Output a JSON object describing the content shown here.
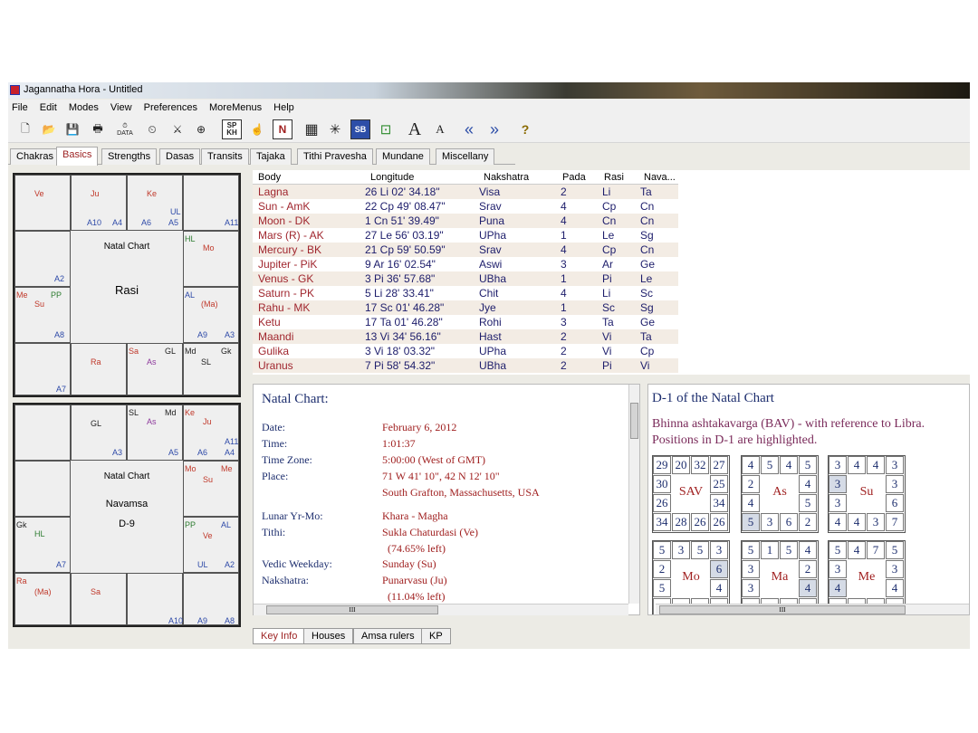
{
  "window": {
    "title": "Jagannatha Hora - Untitled"
  },
  "menu": [
    "File",
    "Edit",
    "Modes",
    "View",
    "Preferences",
    "MoreMenus",
    "Help"
  ],
  "toolbar": {
    "data_label": "DATA",
    "sp_label": "SP",
    "kh_label": "KH",
    "n_label": "N",
    "sb_label": "SB",
    "big_a": "A",
    "small_a": "A",
    "help": "?"
  },
  "tabs": [
    "Chakras",
    "Basics",
    "Strengths",
    "Dasas",
    "Transits",
    "Tajaka",
    "Tithi Pravesha",
    "Mundane",
    "Miscellany"
  ],
  "rasi_chart": {
    "title": "Natal Chart",
    "name": "Rasi",
    "labels": {
      "ve": "Ve",
      "ju": "Ju",
      "ke": "Ke",
      "ul": "UL",
      "a10": "A10",
      "a4": "A4",
      "a6": "A6",
      "a5": "A5",
      "a11": "A11",
      "hl": "HL",
      "mo": "Mo",
      "a2": "A2",
      "me": "Me",
      "pp": "PP",
      "su": "Su",
      "al": "AL",
      "ma": "(Ma)",
      "a8": "A8",
      "a9": "A9",
      "a3": "A3",
      "sa": "Sa",
      "gl": "GL",
      "md": "Md",
      "gk": "Gk",
      "ra": "Ra",
      "as": "As",
      "sl": "SL",
      "a7": "A7"
    }
  },
  "navamsa_chart": {
    "title": "Natal Chart",
    "name": "Navamsa",
    "division": "D-9",
    "labels": {
      "gl": "GL",
      "sl": "SL",
      "md": "Md",
      "as": "As",
      "ke": "Ke",
      "ju": "Ju",
      "a11": "A11",
      "a3": "A3",
      "a5": "A5",
      "a6": "A6",
      "a4": "A4",
      "mo": "Mo",
      "me": "Me",
      "su": "Su",
      "gk": "Gk",
      "hl": "HL",
      "pp": "PP",
      "al": "AL",
      "ve": "Ve",
      "a7": "A7",
      "ul": "UL",
      "a2": "A2",
      "ra": "Ra",
      "ma": "(Ma)",
      "sa": "Sa",
      "a10": "A10",
      "a9": "A9",
      "a8": "A8"
    }
  },
  "body_table": {
    "headers": [
      "Body",
      "Longitude",
      "Nakshatra",
      "Pada",
      "Rasi",
      "Nava..."
    ],
    "rows": [
      [
        "Lagna",
        "26 Li 02' 34.18\"",
        "Visa",
        "2",
        "Li",
        "Ta"
      ],
      [
        "Sun - AmK",
        "22 Cp 49' 08.47\"",
        "Srav",
        "4",
        "Cp",
        "Cn"
      ],
      [
        "Moon - DK",
        "1 Cn 51' 39.49\"",
        "Puna",
        "4",
        "Cn",
        "Cn"
      ],
      [
        "Mars (R) - AK",
        "27 Le 56' 03.19\"",
        "UPha",
        "1",
        "Le",
        "Sg"
      ],
      [
        "Mercury - BK",
        "21 Cp 59' 50.59\"",
        "Srav",
        "4",
        "Cp",
        "Cn"
      ],
      [
        "Jupiter - PiK",
        "9 Ar 16' 02.54\"",
        "Aswi",
        "3",
        "Ar",
        "Ge"
      ],
      [
        "Venus - GK",
        "3 Pi 36' 57.68\"",
        "UBha",
        "1",
        "Pi",
        "Le"
      ],
      [
        "Saturn - PK",
        "5 Li 28' 33.41\"",
        "Chit",
        "4",
        "Li",
        "Sc"
      ],
      [
        "Rahu - MK",
        "17 Sc 01' 46.28\"",
        "Jye",
        "1",
        "Sc",
        "Sg"
      ],
      [
        "Ketu",
        "17 Ta 01' 46.28\"",
        "Rohi",
        "3",
        "Ta",
        "Ge"
      ],
      [
        "Maandi",
        "13 Vi 34' 56.16\"",
        "Hast",
        "2",
        "Vi",
        "Ta"
      ],
      [
        "Gulika",
        "3 Vi 18' 03.32\"",
        "UPha",
        "2",
        "Vi",
        "Cp"
      ],
      [
        "Uranus",
        "7 Pi 58' 54.32\"",
        "UBha",
        "2",
        "Pi",
        "Vi"
      ]
    ]
  },
  "key_info": {
    "heading": "Natal Chart:",
    "date_label": "Date:",
    "date": "February 6, 2012",
    "time_label": "Time:",
    "time": "1:01:37",
    "tz_label": "Time Zone:",
    "tz": "5:00:00 (West of GMT)",
    "place_label": "Place:",
    "place_coords": "71 W 41' 10\", 42 N 12' 10\"",
    "place_name": "South Grafton, Massachusetts, USA",
    "lunar_label": "Lunar Yr-Mo:",
    "lunar": "Khara - Magha",
    "tithi_label": "Tithi:",
    "tithi": "Sukla Chaturdasi (Ve)",
    "tithi_left": "(74.65% left)",
    "weekday_label": "Vedic Weekday:",
    "weekday": "Sunday (Su)",
    "nakshatra_label": "Nakshatra:",
    "nakshatra": "Punarvasu (Ju)",
    "nakshatra_left": "(11.04% left)"
  },
  "bav": {
    "heading": "D-1 of the Natal Chart",
    "line1": "Bhinna ashtakavarga (BAV) - with reference to Libra.",
    "line2": "Positions in D-1 are highlighted.",
    "grids": [
      {
        "name": "SAV",
        "cells": [
          "29",
          "20",
          "32",
          "27",
          "25",
          "34",
          "26",
          "26",
          "28",
          "34",
          "26",
          "30"
        ],
        "hl": []
      },
      {
        "name": "As",
        "cells": [
          "4",
          "5",
          "4",
          "5",
          "4",
          "5",
          "2",
          "6",
          "3",
          "5",
          "4",
          "2"
        ],
        "hl": [
          9
        ]
      },
      {
        "name": "Su",
        "cells": [
          "3",
          "4",
          "4",
          "3",
          "3",
          "6",
          "7",
          "3",
          "4",
          "4",
          "3",
          "3"
        ],
        "hl": [
          11
        ]
      },
      {
        "name": "Mo",
        "cells": [
          "5",
          "3",
          "5",
          "3",
          "6",
          "4",
          "",
          "",
          "",
          "",
          "5",
          "2"
        ],
        "hl": [
          4
        ]
      },
      {
        "name": "Ma",
        "cells": [
          "5",
          "1",
          "5",
          "4",
          "2",
          "4",
          "",
          "",
          "",
          "",
          "3",
          "3"
        ],
        "hl": [
          5
        ]
      },
      {
        "name": "Me",
        "cells": [
          "5",
          "4",
          "7",
          "5",
          "3",
          "4",
          "",
          "",
          "",
          "",
          "4",
          "3"
        ],
        "hl": [
          10
        ]
      }
    ]
  },
  "bottom_tabs": [
    "Key Info",
    "Houses",
    "Amsa rulers",
    "KP"
  ],
  "scroll": {
    "h_grip": "III"
  }
}
